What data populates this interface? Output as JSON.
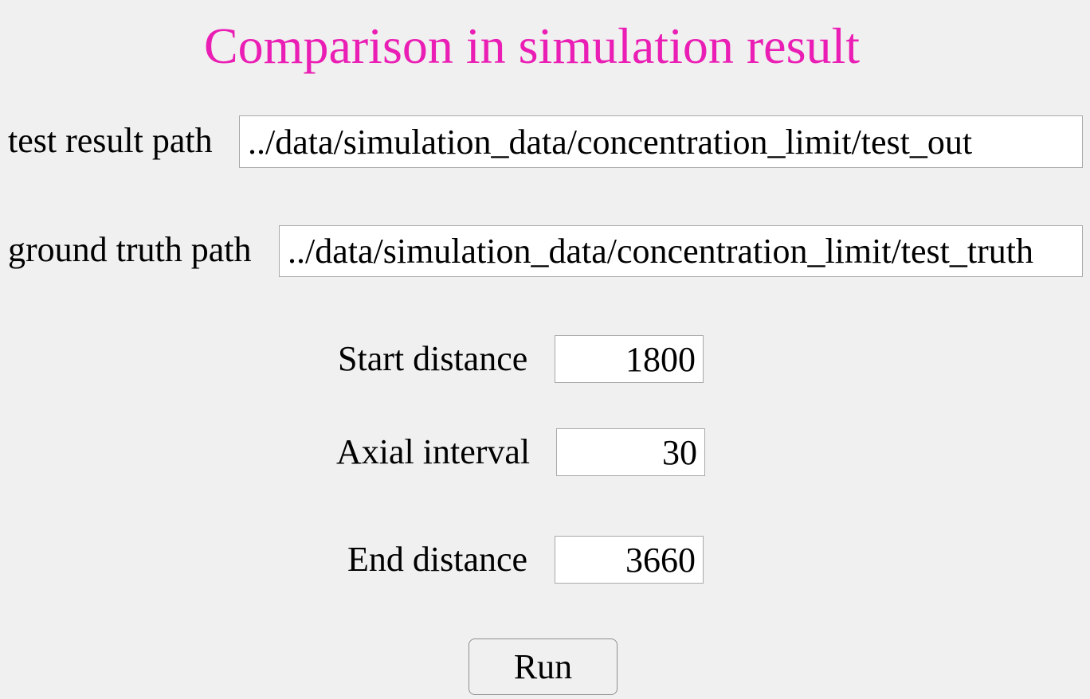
{
  "title": "Comparison in simulation result",
  "test_result": {
    "label": "test result path",
    "value": "../data/simulation_data/concentration_limit/test_out"
  },
  "ground_truth": {
    "label": "ground truth path",
    "value": "../data/simulation_data/concentration_limit/test_truth"
  },
  "start_distance": {
    "label": "Start distance",
    "value": "1800"
  },
  "axial_interval": {
    "label": "Axial interval",
    "value": "30"
  },
  "end_distance": {
    "label": "End distance",
    "value": "3660"
  },
  "run_button": {
    "label": "Run"
  },
  "colors": {
    "title": "#ea1eb4",
    "background": "#f0f0f0"
  }
}
